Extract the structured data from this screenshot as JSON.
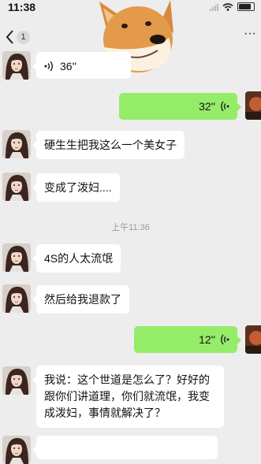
{
  "status_bar": {
    "time": "11:38"
  },
  "nav": {
    "back_count": "1",
    "more": "···"
  },
  "timestamp": "上午11:36",
  "messages": [
    {
      "side": "left",
      "type": "voice",
      "duration": "36''"
    },
    {
      "side": "right",
      "type": "voice",
      "duration": "32''"
    },
    {
      "side": "left",
      "type": "text",
      "text": "硬生生把我这么一个美女子"
    },
    {
      "side": "left",
      "type": "text",
      "text": "变成了泼妇...."
    },
    {
      "side": "left",
      "type": "text",
      "text": "4S的人太流氓"
    },
    {
      "side": "left",
      "type": "text",
      "text": "然后给我退款了"
    },
    {
      "side": "right",
      "type": "voice",
      "duration": "12''"
    },
    {
      "side": "left",
      "type": "text",
      "text": "我说：这个世道是怎么了？好好的跟你们讲道理，你们就流氓，我变成泼妇，事情就解决了？"
    }
  ],
  "colors": {
    "background": "#ededed",
    "bubble_self": "#95ec69",
    "bubble_other": "#ffffff"
  },
  "icons": [
    "back-chevron-icon",
    "signal-icon",
    "wifi-icon",
    "battery-icon",
    "voice-wave-icon",
    "avatar-icon",
    "doge-sticker"
  ]
}
